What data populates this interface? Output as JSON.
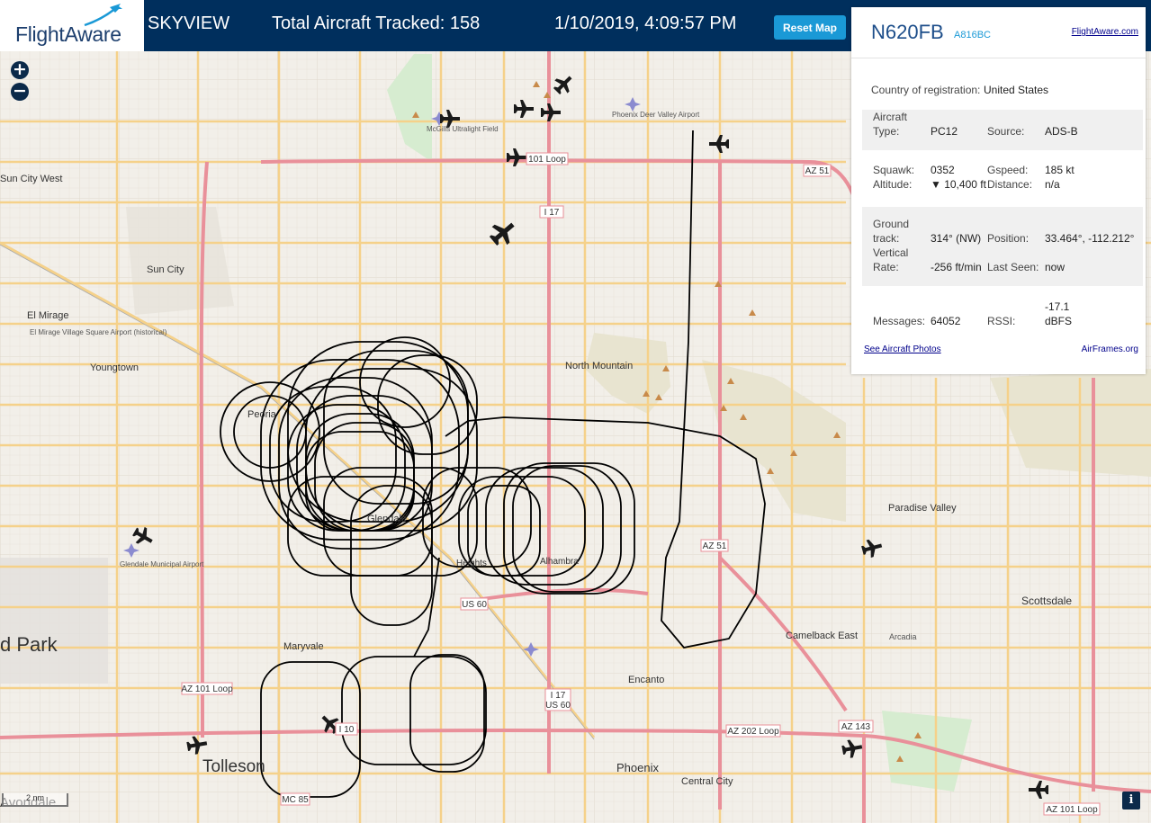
{
  "header": {
    "logo_text": "FlightAware",
    "app_name": "SKYVIEW",
    "aircraft_tracked": "Total Aircraft Tracked: 158",
    "datetime": "1/10/2019, 4:09:57 PM",
    "reset_label": "Reset Map"
  },
  "map": {
    "zoom_in": "+",
    "zoom_out": "−",
    "scale_label": "2 nm",
    "info_label": "i",
    "labels": {
      "sun_city_west": "Sun City West",
      "sun_city": "Sun City",
      "el_mirage": "El Mirage",
      "el_mirage_airport": "El Mirage Village Square Airport (historical)",
      "youngtown": "Youngtown",
      "peoria": "Peoria",
      "glendale": "Glendale",
      "glendale_airport": "Glendale Municipal Airport",
      "north_mountain": "North Mountain",
      "paradise_valley": "Paradise Valley",
      "scottsdale": "Scottsdale",
      "maryvale": "Maryvale",
      "camelback_east": "Camelback East",
      "encanto": "Encanto",
      "phoenix": "Phoenix",
      "central_city": "Central City",
      "tolleson": "Tolleson",
      "goodyear_park": "d Park",
      "mcgills": "McGills Ultralight Field",
      "deer_valley": "Phoenix Deer Valley Airport",
      "alhambra": "Alhambra",
      "arcadia": "Arcadia",
      "avondale": "Avondale",
      "heights": "Heights"
    },
    "shields": {
      "loop101_n": "101 Loop",
      "i17_n": "I 17",
      "az51_n": "AZ 51",
      "az51_s": "AZ 51",
      "us60": "US 60",
      "i17_s": "I 17",
      "us60_s": "US 60",
      "loop101_w": "AZ 101 Loop",
      "i10": "I 10",
      "az202": "AZ 202 Loop",
      "az143": "AZ 143",
      "loop101_e": "AZ 101 Loop",
      "mc85": "MC 85"
    }
  },
  "panel": {
    "registration": "N620FB",
    "hex": "A816BC",
    "fa_link": "FlightAware.com",
    "country_label": "Country of registration:",
    "country": "United States",
    "aircraft_type_label_1": "Aircraft",
    "aircraft_type_label_2": "Type:",
    "aircraft_type": "PC12",
    "source_label": "Source:",
    "source": "ADS-B",
    "squawk_label": "Squawk:",
    "squawk": "0352",
    "gspeed_label": "Gspeed:",
    "gspeed": "185 kt",
    "altitude_label": "Altitude:",
    "altitude": "▼ 10,400 ft",
    "distance_label": "Distance:",
    "distance": "n/a",
    "ground_track_label_1": "Ground",
    "ground_track_label_2": "track:",
    "ground_track": "314° (NW)",
    "position_label": "Position:",
    "position": "33.464°, -112.212°",
    "vertical_rate_label_1": "Vertical",
    "vertical_rate_label_2": "Rate:",
    "vertical_rate": "-256 ft/min",
    "last_seen_label": "Last Seen:",
    "last_seen": "now",
    "messages_label": "Messages:",
    "messages": "64052",
    "rssi_label": "RSSI:",
    "rssi_1": "-17.1",
    "rssi_2": "dBFS",
    "photos_link": "See Aircraft Photos",
    "airframes_link": "AirFrames.org"
  },
  "colors": {
    "header_bg": "#002f5d",
    "accent": "#1a99d6",
    "map_bg": "#f2efe9",
    "road_major": "#f5d18a",
    "road_highway": "#e9909a",
    "track": "#000000"
  }
}
